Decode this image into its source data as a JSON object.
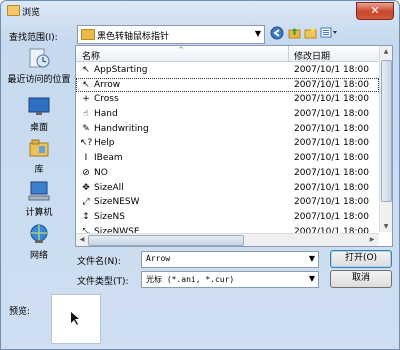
{
  "window": {
    "title": "浏览",
    "close_glyph": "✕"
  },
  "lookin": {
    "label": "查找范围(I):",
    "value": "黑色转轴鼠标指针"
  },
  "places": [
    {
      "label": "最近访问的位置",
      "icon": "recent-places-icon"
    },
    {
      "label": "桌面",
      "icon": "desktop-icon"
    },
    {
      "label": "库",
      "icon": "libraries-icon"
    },
    {
      "label": "计算机",
      "icon": "computer-icon"
    },
    {
      "label": "网络",
      "icon": "network-icon"
    }
  ],
  "filelist": {
    "col_name": "名称",
    "col_date": "修改日期",
    "rows": [
      {
        "name": "AppStarting",
        "date": "2007/10/1 18:00",
        "glyph": "↖"
      },
      {
        "name": "Arrow",
        "date": "2007/10/1 18:00",
        "glyph": "↖",
        "selected": true
      },
      {
        "name": "Cross",
        "date": "2007/10/1 18:00",
        "glyph": "+"
      },
      {
        "name": "Hand",
        "date": "2007/10/1 18:00",
        "glyph": "☝"
      },
      {
        "name": "Handwriting",
        "date": "2007/10/1 18:00",
        "glyph": "✎"
      },
      {
        "name": "Help",
        "date": "2007/10/1 18:00",
        "glyph": "↖?"
      },
      {
        "name": "IBeam",
        "date": "2007/10/1 18:00",
        "glyph": "I"
      },
      {
        "name": "NO",
        "date": "2007/10/1 18:00",
        "glyph": "⊘"
      },
      {
        "name": "SizeAll",
        "date": "2007/10/1 18:00",
        "glyph": "✥"
      },
      {
        "name": "SizeNESW",
        "date": "2007/10/1 18:00",
        "glyph": "⤢"
      },
      {
        "name": "SizeNS",
        "date": "2007/10/1 18:00",
        "glyph": "↕"
      },
      {
        "name": "SizeNWSE",
        "date": "2007/10/1 18:00",
        "glyph": "⤡"
      }
    ]
  },
  "filename": {
    "label": "文件名(N):",
    "value": "Arrow"
  },
  "filetype": {
    "label": "文件类型(T):",
    "value": "光标 (*.ani, *.cur)"
  },
  "buttons": {
    "open": "打开(O)",
    "cancel": "取消"
  },
  "preview": {
    "label": "预览:"
  }
}
